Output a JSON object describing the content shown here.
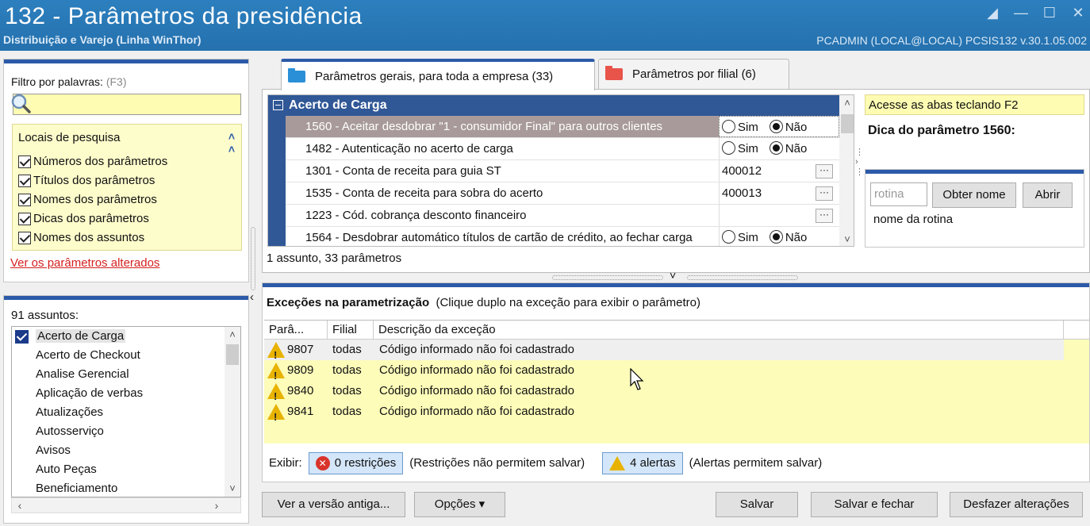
{
  "window": {
    "title": "132 - Parâmetros da presidência",
    "subtitle": "Distribuição e Varejo (Linha WinThor)",
    "status": "PCADMIN (LOCAL@LOCAL)  PCSIS132  v.30.1.05.002"
  },
  "filter": {
    "label": "Filtro por palavras:",
    "hotkey": "(F3)",
    "search_value": "",
    "locais_title": "Locais de pesquisa",
    "options": [
      {
        "label": "Números dos parâmetros",
        "checked": true
      },
      {
        "label": "Títulos dos parâmetros",
        "checked": true
      },
      {
        "label": "Nomes dos parâmetros",
        "checked": true
      },
      {
        "label": "Dicas dos parâmetros",
        "checked": true
      },
      {
        "label": "Nomes dos assuntos",
        "checked": true
      }
    ],
    "changed_link": "Ver os parâmetros alterados"
  },
  "assuntos": {
    "count_label": "91 assuntos:",
    "items": [
      "Acerto de Carga",
      "Acerto de Checkout",
      "Analise Gerencial",
      "Aplicação de verbas",
      "Atualizações",
      "Autosserviço",
      "Avisos",
      "Auto Peças",
      "Beneficiamento"
    ],
    "selected_index": 0
  },
  "tabs": [
    {
      "label": "Parâmetros gerais, para toda a empresa",
      "count": "(33)",
      "active": true,
      "color": "#2a8fd6"
    },
    {
      "label": "Parâmetros por filial",
      "count": "(6)",
      "active": false,
      "color": "#e8534a"
    }
  ],
  "params": {
    "group": "Acerto de Carga",
    "rows": [
      {
        "desc": "1560 - Aceitar desdobrar \"1 - consumidor Final\" para outros clientes",
        "type": "radio",
        "value": "Não",
        "selected": true
      },
      {
        "desc": "1482 - Autenticação no acerto de carga",
        "type": "radio",
        "value": "Não",
        "selected": false
      },
      {
        "desc": "1301 - Conta de receita para guia ST",
        "type": "lookup",
        "value": "400012",
        "selected": false
      },
      {
        "desc": "1535 - Conta de receita para sobra do acerto",
        "type": "lookup",
        "value": "400013",
        "selected": false
      },
      {
        "desc": "1223 - Cód. cobrança desconto financeiro",
        "type": "lookup",
        "value": "",
        "selected": false
      },
      {
        "desc": "1564 - Desdobrar automático títulos de cartão de crédito, ao fechar carga",
        "type": "radio",
        "value": "Não",
        "selected": false
      }
    ],
    "radio_yes": "Sim",
    "radio_no": "Não",
    "ellipsis": "···",
    "footer": "1 assunto, 33 parâmetros"
  },
  "hint": {
    "banner": "Acesse as abas teclando F2",
    "title": "Dica do parâmetro 1560:",
    "rotina_placeholder": "rotina",
    "obter_nome": "Obter nome",
    "abrir": "Abrir",
    "rotina_name": "nome da rotina"
  },
  "excecoes": {
    "title": "Exceções na parametrização",
    "subtitle": "(Clique duplo na exceção para exibir o parâmetro)",
    "columns": [
      "Parâ...",
      "Filial",
      "Descrição da exceção"
    ],
    "rows": [
      {
        "param": "9807",
        "filial": "todas",
        "desc": "Código informado não foi cadastrado"
      },
      {
        "param": "9809",
        "filial": "todas",
        "desc": "Código informado não foi cadastrado"
      },
      {
        "param": "9840",
        "filial": "todas",
        "desc": "Código informado não foi cadastrado"
      },
      {
        "param": "9841",
        "filial": "todas",
        "desc": "Código informado não foi cadastrado"
      }
    ],
    "exibir_label": "Exibir:",
    "restricoes_btn": "0 restrições",
    "restricoes_note": "(Restrições não permitem salvar)",
    "alertas_btn": "4 alertas",
    "alertas_note": "(Alertas permitem salvar)"
  },
  "buttons": {
    "ver_versao": "Ver a versão antiga...",
    "opcoes": "Opções ▾",
    "salvar": "Salvar",
    "salvar_fechar": "Salvar e fechar",
    "desfazer": "Desfazer alterações"
  }
}
